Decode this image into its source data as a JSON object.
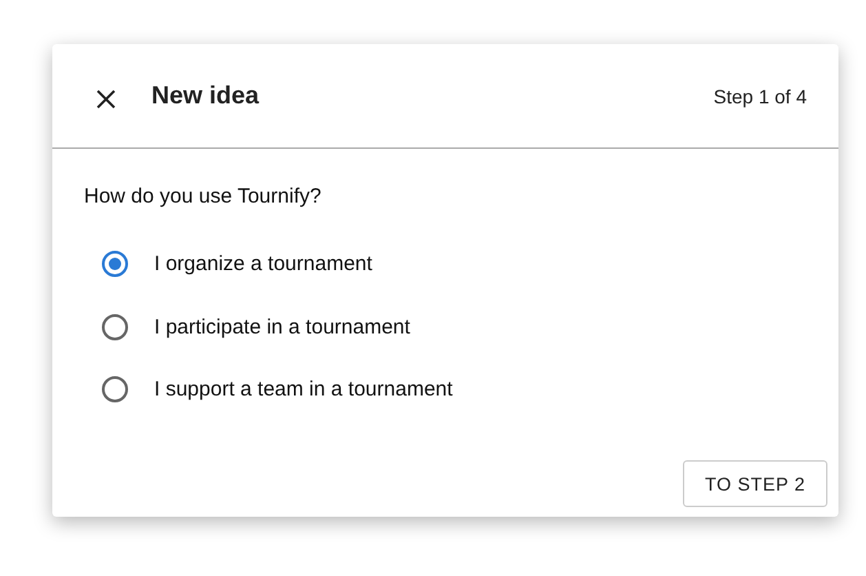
{
  "dialog": {
    "title": "New idea",
    "step": "Step 1 of 4"
  },
  "question": "How do you use Tournify?",
  "options": [
    {
      "label": "I organize a tournament",
      "selected": true
    },
    {
      "label": "I participate in a tournament",
      "selected": false
    },
    {
      "label": "I support a team in a tournament",
      "selected": false
    }
  ],
  "buttons": [
    "TO STEP 2"
  ]
}
